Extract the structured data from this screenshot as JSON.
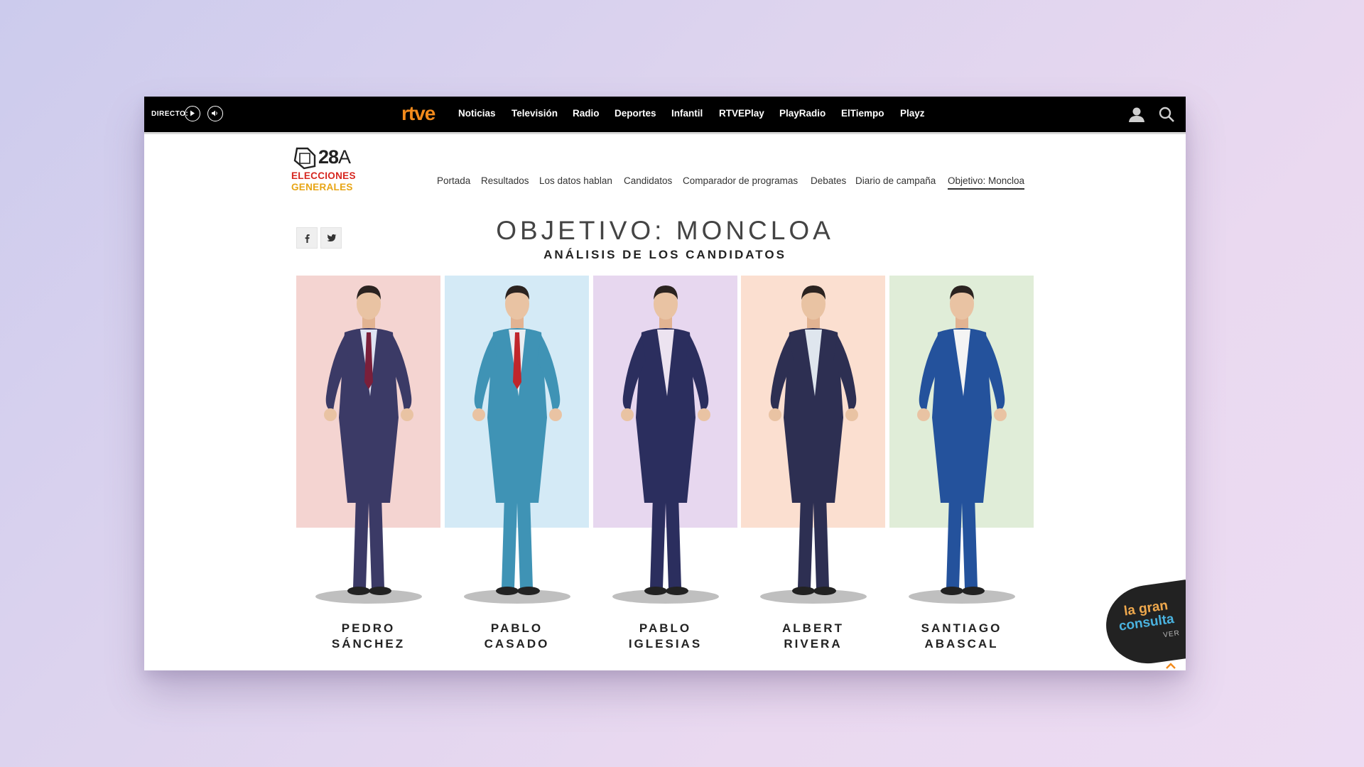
{
  "topbar": {
    "directo_label": "DIRECTO:",
    "brand": "rtve",
    "nav": [
      "Noticias",
      "Televisión",
      "Radio",
      "Deportes",
      "Infantil",
      "RTVEPlay",
      "PlayRadio",
      "ElTiempo",
      "Playz"
    ]
  },
  "section": {
    "logo_num": "28",
    "logo_letter": "A",
    "logo_line1": "ELECCIONES",
    "logo_line2": "GENERALES",
    "subnav": [
      "Portada",
      "Resultados",
      "Los datos hablan",
      "Candidatos",
      "Comparador de programas",
      "Debates",
      "Diario de campaña",
      "Objetivo: Moncloa"
    ],
    "active": "Objetivo: Moncloa"
  },
  "page": {
    "title": "OBJETIVO: MONCLOA",
    "subtitle": "ANÁLISIS DE LOS CANDIDATOS"
  },
  "candidates": [
    {
      "first": "PEDRO",
      "last": "SÁNCHEZ",
      "bg": "#f4d4d1",
      "suit": "#3b3a66",
      "tie": "#7a1f3a",
      "shirt": "#dfe4f2"
    },
    {
      "first": "PABLO",
      "last": "CASADO",
      "bg": "#d4eaf6",
      "suit": "#3f93b5",
      "tie": "#c0262b",
      "shirt": "#e9eef2"
    },
    {
      "first": "PABLO",
      "last": "IGLESIAS",
      "bg": "#e7d7ef",
      "suit": "#2b2e5e",
      "tie": "",
      "shirt": "#ece3f0"
    },
    {
      "first": "ALBERT",
      "last": "RIVERA",
      "bg": "#fbdfd0",
      "suit": "#2d2f52",
      "tie": "",
      "shirt": "#dfe6ee"
    },
    {
      "first": "SANTIAGO",
      "last": "ABASCAL",
      "bg": "#e0edd8",
      "suit": "#24529c",
      "tie": "",
      "shirt": "#f4f4f4"
    }
  ],
  "badge": {
    "line1": "la gran",
    "line2": "consulta",
    "cta": "VER"
  }
}
